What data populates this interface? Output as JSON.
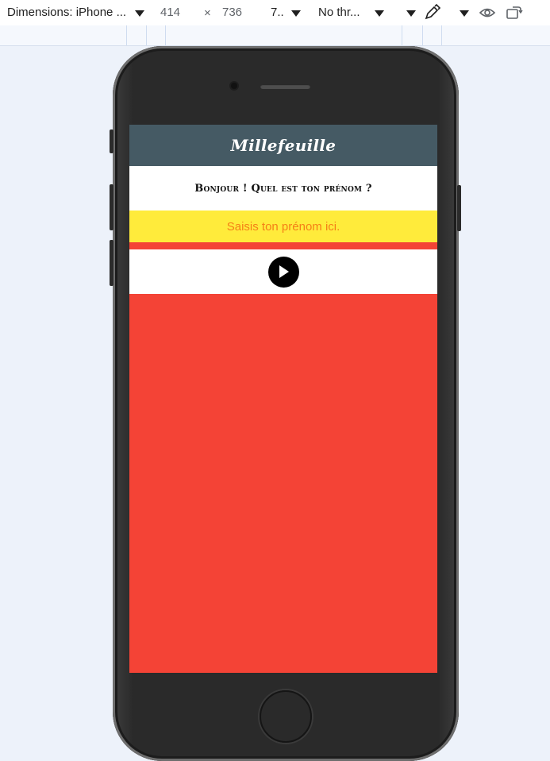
{
  "devtools": {
    "device_label": "Dimensions: iPhone ...",
    "width": "414",
    "times": "×",
    "height": "736",
    "zoom": "7..",
    "throttle": "No thr..."
  },
  "app": {
    "brand": "Millefeuille",
    "question": "Bonjour ! Quel est ton prénom ?",
    "input_placeholder": "Saisis ton prénom ici.",
    "colors": {
      "header": "#455a64",
      "input": "#ffeb3b",
      "background": "#f44336"
    }
  },
  "icons": [
    "chevron-down-icon",
    "eyedropper-icon",
    "eye-icon",
    "rotate-icon",
    "play-icon"
  ]
}
